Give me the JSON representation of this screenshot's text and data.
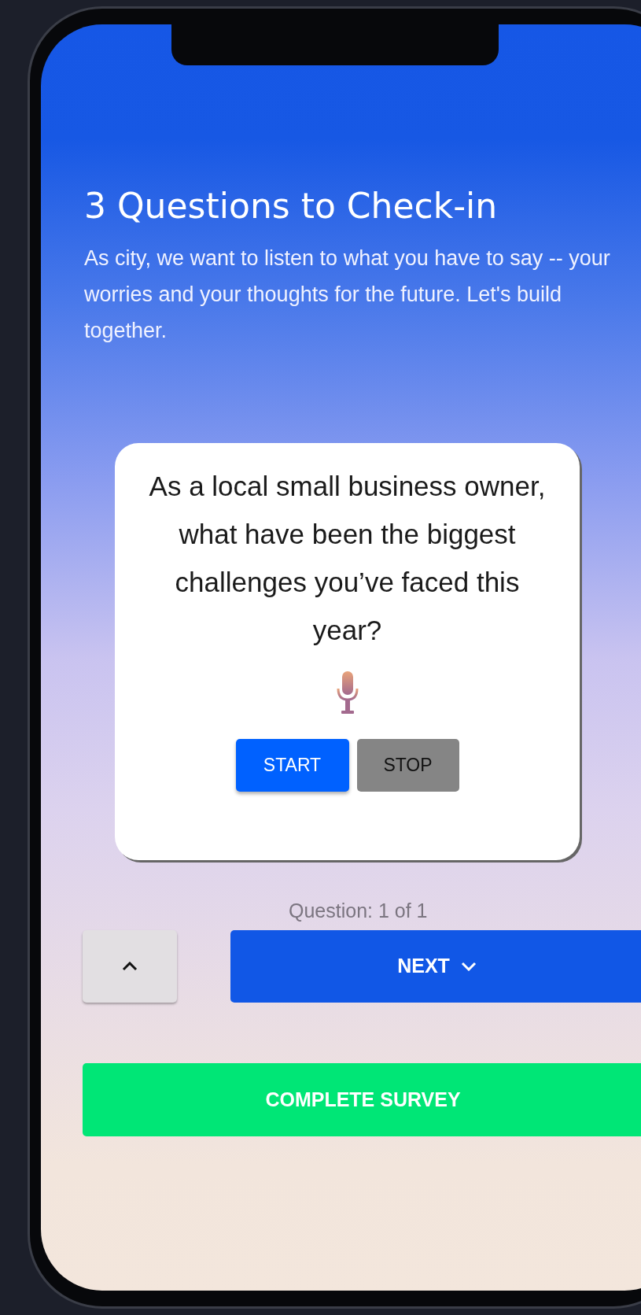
{
  "header": {
    "title": "3 Questions to Check-in",
    "description": "As city, we want to listen to what you have to say -- your worries and your thoughts for the future. Let's build together."
  },
  "question_card": {
    "question": "As a local small business owner, what have been the biggest challenges you’ve faced this year?",
    "buttons": [
      {
        "label": "START",
        "kind": "primary"
      },
      {
        "label": "STOP",
        "kind": "secondary"
      }
    ]
  },
  "progress": "Question: 1 of 1",
  "navigation": {
    "next_label": "NEXT"
  },
  "complete_button": "COMPLETE SURVEY"
}
